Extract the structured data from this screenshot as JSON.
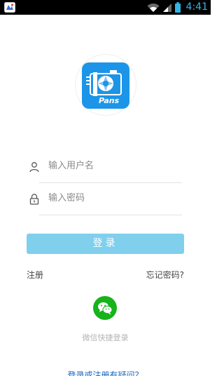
{
  "status_bar": {
    "time": "4:41",
    "icons": [
      "notification-icon",
      "wifi-icon",
      "signal-icon",
      "battery-icon"
    ],
    "accent_color": "#33b5e5"
  },
  "logo": {
    "text": "Pans",
    "icon": "camera-aperture-logo"
  },
  "form": {
    "username_placeholder": "输入用户名",
    "password_placeholder": "输入密码",
    "username_icon": "user-icon",
    "password_icon": "lock-icon"
  },
  "login_button": {
    "label": "登录",
    "color": "#80cfed"
  },
  "links": {
    "register": "注册",
    "forgot_password": "忘记密码?"
  },
  "wechat": {
    "label": "微信快捷登录",
    "icon": "wechat-icon",
    "color": "#16b31a"
  },
  "help": {
    "label": "登录或注册有疑问？"
  }
}
